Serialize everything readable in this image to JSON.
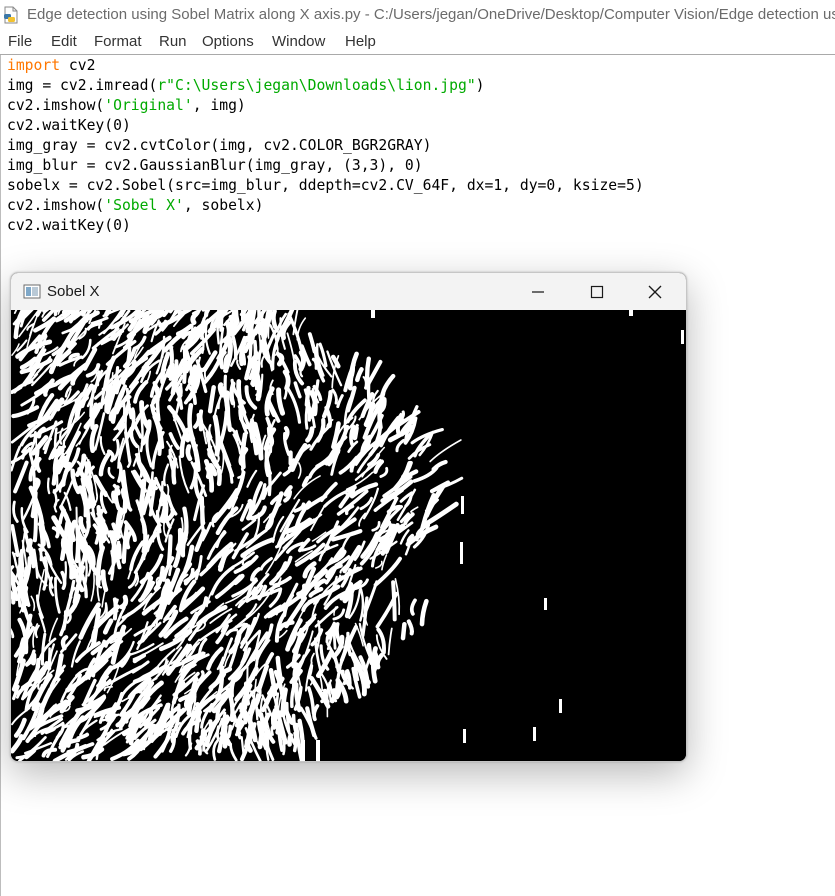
{
  "window": {
    "title": "Edge detection using Sobel Matrix along X axis.py - C:/Users/jegan/OneDrive/Desktop/Computer Vision/Edge detection us",
    "icon": "python-file-icon"
  },
  "menu": {
    "file": "File",
    "edit": "Edit",
    "format": "Format",
    "run": "Run",
    "options": "Options",
    "window": "Window",
    "help": "Help"
  },
  "code": {
    "line1": {
      "kw": "import",
      "rest": " cv2"
    },
    "line2": {
      "pre": "img = cv2.imread(",
      "str": "r\"C:\\Users\\jegan\\Downloads\\lion.jpg\"",
      "post": ")"
    },
    "line3": {
      "pre": "cv2.imshow(",
      "str": "'Original'",
      "post": ", img)"
    },
    "line4": "cv2.waitKey(0)",
    "line5": "img_gray = cv2.cvtColor(img, cv2.COLOR_BGR2GRAY)",
    "line6": "img_blur = cv2.GaussianBlur(img_gray, (3,3), 0)",
    "line7": "sobelx = cv2.Sobel(src=img_blur, ddepth=cv2.CV_64F, dx=1, dy=0, ksize=5)",
    "line8": {
      "pre": "cv2.imshow(",
      "str": "'Sobel X'",
      "post": ", sobelx)"
    },
    "line9": "cv2.waitKey(0)"
  },
  "image_window": {
    "title": "Sobel X",
    "icon": "image-window-icon",
    "controls": [
      "minimize-icon",
      "maximize-icon",
      "close-icon"
    ],
    "background_color": "#000000",
    "foreground_color": "#ffffff"
  },
  "colors": {
    "keyword": "#ff7700",
    "string": "#00aa00",
    "text": "#000000"
  }
}
